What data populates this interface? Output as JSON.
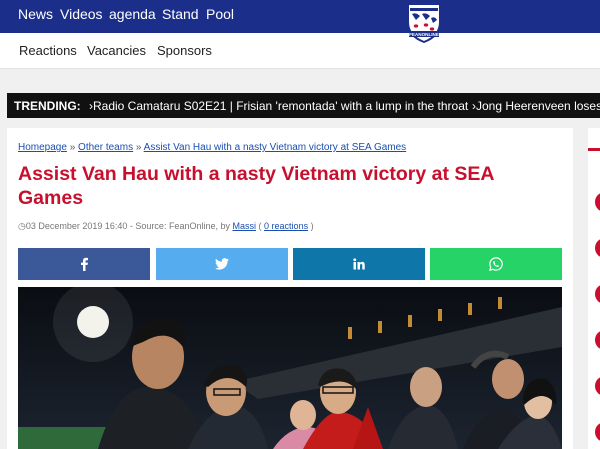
{
  "nav": {
    "items": [
      "News",
      "Videos",
      "agenda",
      "Stand",
      "Pool"
    ]
  },
  "logo": {
    "text": "FEANONLINE"
  },
  "subnav": {
    "items": [
      "Reactions",
      "Vacancies",
      "Sponsors"
    ]
  },
  "trending": {
    "label": "TRENDING:",
    "items": [
      "›Radio Camataru S02E21 | Frisian 'remontada' with a lump in the throat",
      "›Jong Heerenveen loses with"
    ]
  },
  "article": {
    "breadcrumb": {
      "home": "Homepage",
      "sep": "»",
      "section": "Other teams",
      "current": "Assist Van Hau with a nasty Vietnam victory at SEA Games"
    },
    "title": "Assist Van Hau with a nasty Vietnam victory at SEA Games",
    "meta": {
      "date": "◷03 December 2019 16:40 - Source: FeanOnline, by",
      "author": "Massi",
      "open": "(",
      "reactions": "0 reactions",
      "close": ")"
    }
  },
  "share": [
    {
      "icon": "facebook-icon",
      "color": "#3b5998"
    },
    {
      "icon": "twitter-icon",
      "color": "#55acee"
    },
    {
      "icon": "linkedin-icon",
      "color": "#0e76a8"
    },
    {
      "icon": "whatsapp-icon",
      "color": "#25d366"
    }
  ],
  "colors": {
    "nav_bg": "#1b2f8a",
    "accent_red": "#c8102e",
    "link_blue": "#1a4fb0",
    "trending_bg": "#111111"
  }
}
